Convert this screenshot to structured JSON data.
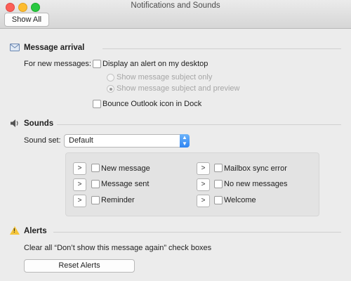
{
  "window": {
    "title": "Notifications and Sounds"
  },
  "toolbar": {
    "show_all_label": "Show All"
  },
  "message_arrival": {
    "title": "Message arrival",
    "for_new_messages_label": "For new messages:",
    "display_alert_label": "Display an alert on my desktop",
    "display_alert_checked": false,
    "radio_subject_only": "Show message subject only",
    "radio_subject_preview": "Show message subject and preview",
    "bounce_label": "Bounce Outlook icon in Dock",
    "bounce_checked": false
  },
  "sounds": {
    "title": "Sounds",
    "sound_set_label": "Sound set:",
    "sound_set_value": "Default",
    "play_glyph": ">",
    "items": [
      {
        "label": "New message",
        "checked": false
      },
      {
        "label": "Message sent",
        "checked": false
      },
      {
        "label": "Reminder",
        "checked": false
      },
      {
        "label": "Mailbox sync error",
        "checked": false
      },
      {
        "label": "No new messages",
        "checked": false
      },
      {
        "label": "Welcome",
        "checked": false
      }
    ]
  },
  "alerts": {
    "title": "Alerts",
    "description": "Clear all “Don’t show this message again” check boxes",
    "reset_label": "Reset Alerts",
    "icon_glyph": "!"
  },
  "icons": {
    "envelope": "envelope-icon",
    "speaker": "speaker-icon",
    "warning": "warning-icon"
  }
}
